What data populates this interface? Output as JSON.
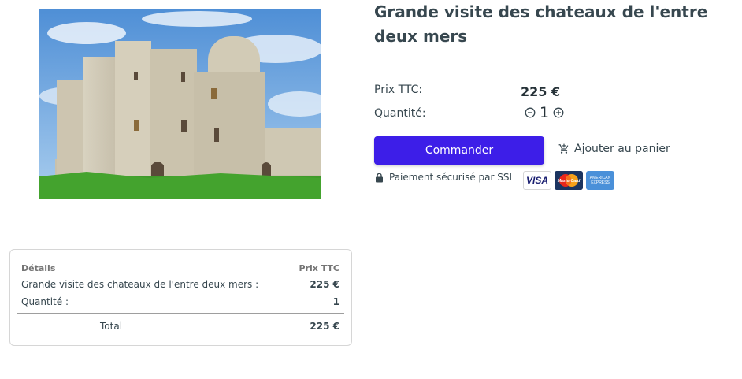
{
  "product": {
    "title": "Grande visite des chateaux de l'entre deux mers",
    "image_alt": "château médiéval"
  },
  "pricing": {
    "price_label": "Prix TTC:",
    "price_value": "225 €",
    "quantity_label": "Quantité:",
    "quantity_value": "1"
  },
  "actions": {
    "order_label": "Commander",
    "cart_label": "Ajouter au panier"
  },
  "payment": {
    "ssl_text": "Paiement sécurisé par SSL",
    "cards": [
      "VISA",
      "MasterCard",
      "AMERICAN EXPRESS"
    ]
  },
  "summary": {
    "details_header": "Détails",
    "price_header": "Prix TTC",
    "item_label": "Grande visite des chateaux de l'entre deux mers :",
    "item_price": "225 €",
    "qty_label": "Quantité :",
    "qty_value": "1",
    "total_label": "Total",
    "total_value": "225 €"
  },
  "colors": {
    "primary_button": "#3d1ee8",
    "text": "#37474f"
  }
}
